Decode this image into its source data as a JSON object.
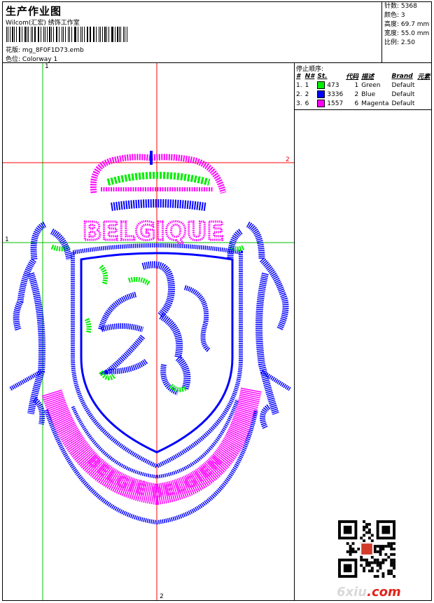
{
  "header": {
    "title": "生产作业图",
    "subtitle": "Wilcom(汇宏) 绣饰工作室",
    "pattern_label": "花版:",
    "pattern_value": "mg_8F0F1D73.emb",
    "colorway_label": "色位:",
    "colorway_value": "Colorway 1"
  },
  "stats": {
    "stitches": "针数: 5368",
    "colors": "颜色: 3",
    "height": "高度: 69.7 mm",
    "width": "宽度: 55.0 mm",
    "scale": "比例: 2.50"
  },
  "stop_sequence": {
    "label": "停止顺序:",
    "columns": [
      "#",
      "N#",
      "St.",
      "代码",
      "描述",
      "Brand",
      "元素"
    ],
    "rows": [
      {
        "idx": "1.",
        "n": "1",
        "st": "473",
        "code": "1",
        "desc": "Green",
        "brand": "Default",
        "color": "#00ee00"
      },
      {
        "idx": "2.",
        "n": "2",
        "st": "3336",
        "code": "2",
        "desc": "Blue",
        "brand": "Default",
        "color": "#0000ff"
      },
      {
        "idx": "3.",
        "n": "6",
        "st": "1557",
        "code": "6",
        "desc": "Magenta",
        "brand": "Default",
        "color": "#ff00ff"
      }
    ]
  },
  "guides": {
    "v1": "1",
    "h1": "1",
    "h2": "2",
    "v2": "2"
  },
  "design": {
    "text_top": "BELGIQUE",
    "text_bottom": "BELGIË BELGIEN"
  },
  "watermark": {
    "prefix": "6xiu",
    "suffix": ".com"
  },
  "colors": {
    "green": "#00ee00",
    "blue": "#0000ff",
    "magenta": "#ff00ff",
    "guide_green": "#00c000",
    "guide_red": "#ff0000"
  }
}
